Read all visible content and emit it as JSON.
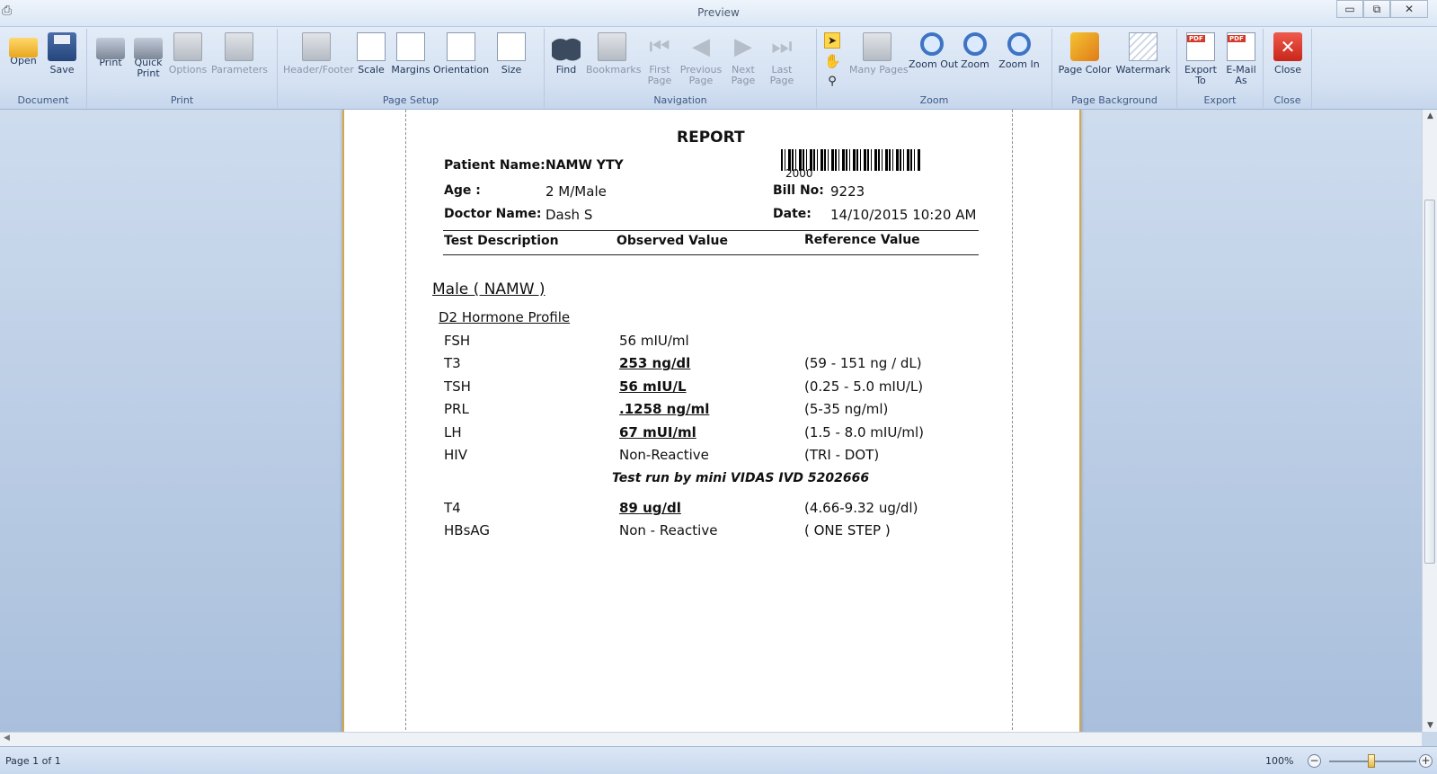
{
  "window": {
    "title": "Preview",
    "controls": [
      "▭",
      "⧉",
      "✕"
    ]
  },
  "ribbon": {
    "groups": {
      "document": "Document",
      "print": "Print",
      "page_setup": "Page Setup",
      "navigation": "Navigation",
      "zoom": "Zoom",
      "page_background": "Page Background",
      "export": "Export",
      "close": "Close"
    },
    "buttons": {
      "open": "Open",
      "save": "Save",
      "print": "Print",
      "quick_print_1": "Quick",
      "quick_print_2": "Print",
      "options": "Options",
      "parameters": "Parameters",
      "header_footer": "Header/Footer",
      "scale": "Scale",
      "margins": "Margins",
      "orientation": "Orientation",
      "size": "Size",
      "find": "Find",
      "bookmarks": "Bookmarks",
      "first_page_1": "First",
      "first_page_2": "Page",
      "previous_page_1": "Previous",
      "previous_page_2": "Page",
      "next_page_1": "Next",
      "next_page_2": "Page",
      "last_page_1": "Last",
      "last_page_2": "Page",
      "many_pages": "Many Pages",
      "zoom_out": "Zoom Out",
      "zoom": "Zoom",
      "zoom_in": "Zoom In",
      "page_color": "Page Color",
      "watermark": "Watermark",
      "export_to_1": "Export",
      "export_to_2": "To",
      "email_as_1": "E-Mail",
      "email_as_2": "As",
      "close": "Close"
    }
  },
  "report": {
    "title": "REPORT",
    "barcode_number": "2000",
    "patient_name_label": "Patient Name:",
    "patient_name": "NAMW YTY",
    "age_label": "Age :",
    "age": "2 M/Male",
    "doctor_label": "Doctor Name:",
    "doctor": "Dash S",
    "bill_label": "Bill No:",
    "bill": "9223",
    "date_label": "Date:",
    "date": "14/10/2015 10:20 AM",
    "columns": [
      "Test Description",
      "Observed Value",
      "Reference Value"
    ],
    "section": "Male ( NAMW )",
    "profile": "D2 Hormone Profile",
    "tests": [
      {
        "name": "FSH",
        "value": "56 mIU/ml",
        "ref": ""
      },
      {
        "name": "T3",
        "value": "253 ng/dl",
        "ref": "(59 - 151 ng / dL)"
      },
      {
        "name": "TSH",
        "value": "56 mIU/L",
        "ref": "(0.25 - 5.0 mIU/L)"
      },
      {
        "name": "PRL",
        "value": ".1258 ng/ml",
        "ref": "(5-35 ng/ml)"
      },
      {
        "name": "LH",
        "value": "67 mUI/ml",
        "ref": "(1.5 - 8.0 mIU/ml)"
      },
      {
        "name": "HIV",
        "value": "Non-Reactive",
        "ref": "(TRI - DOT)"
      }
    ],
    "note": "Test run by mini VIDAS IVD 5202666",
    "tests2": [
      {
        "name": "T4",
        "value": "89 ug/dl",
        "ref": "(4.66-9.32 ug/dl)"
      },
      {
        "name": "HBsAG",
        "value": "Non - Reactive",
        "ref": "( ONE STEP )"
      }
    ]
  },
  "status": {
    "page": "Page 1 of 1",
    "zoom": "100%"
  }
}
